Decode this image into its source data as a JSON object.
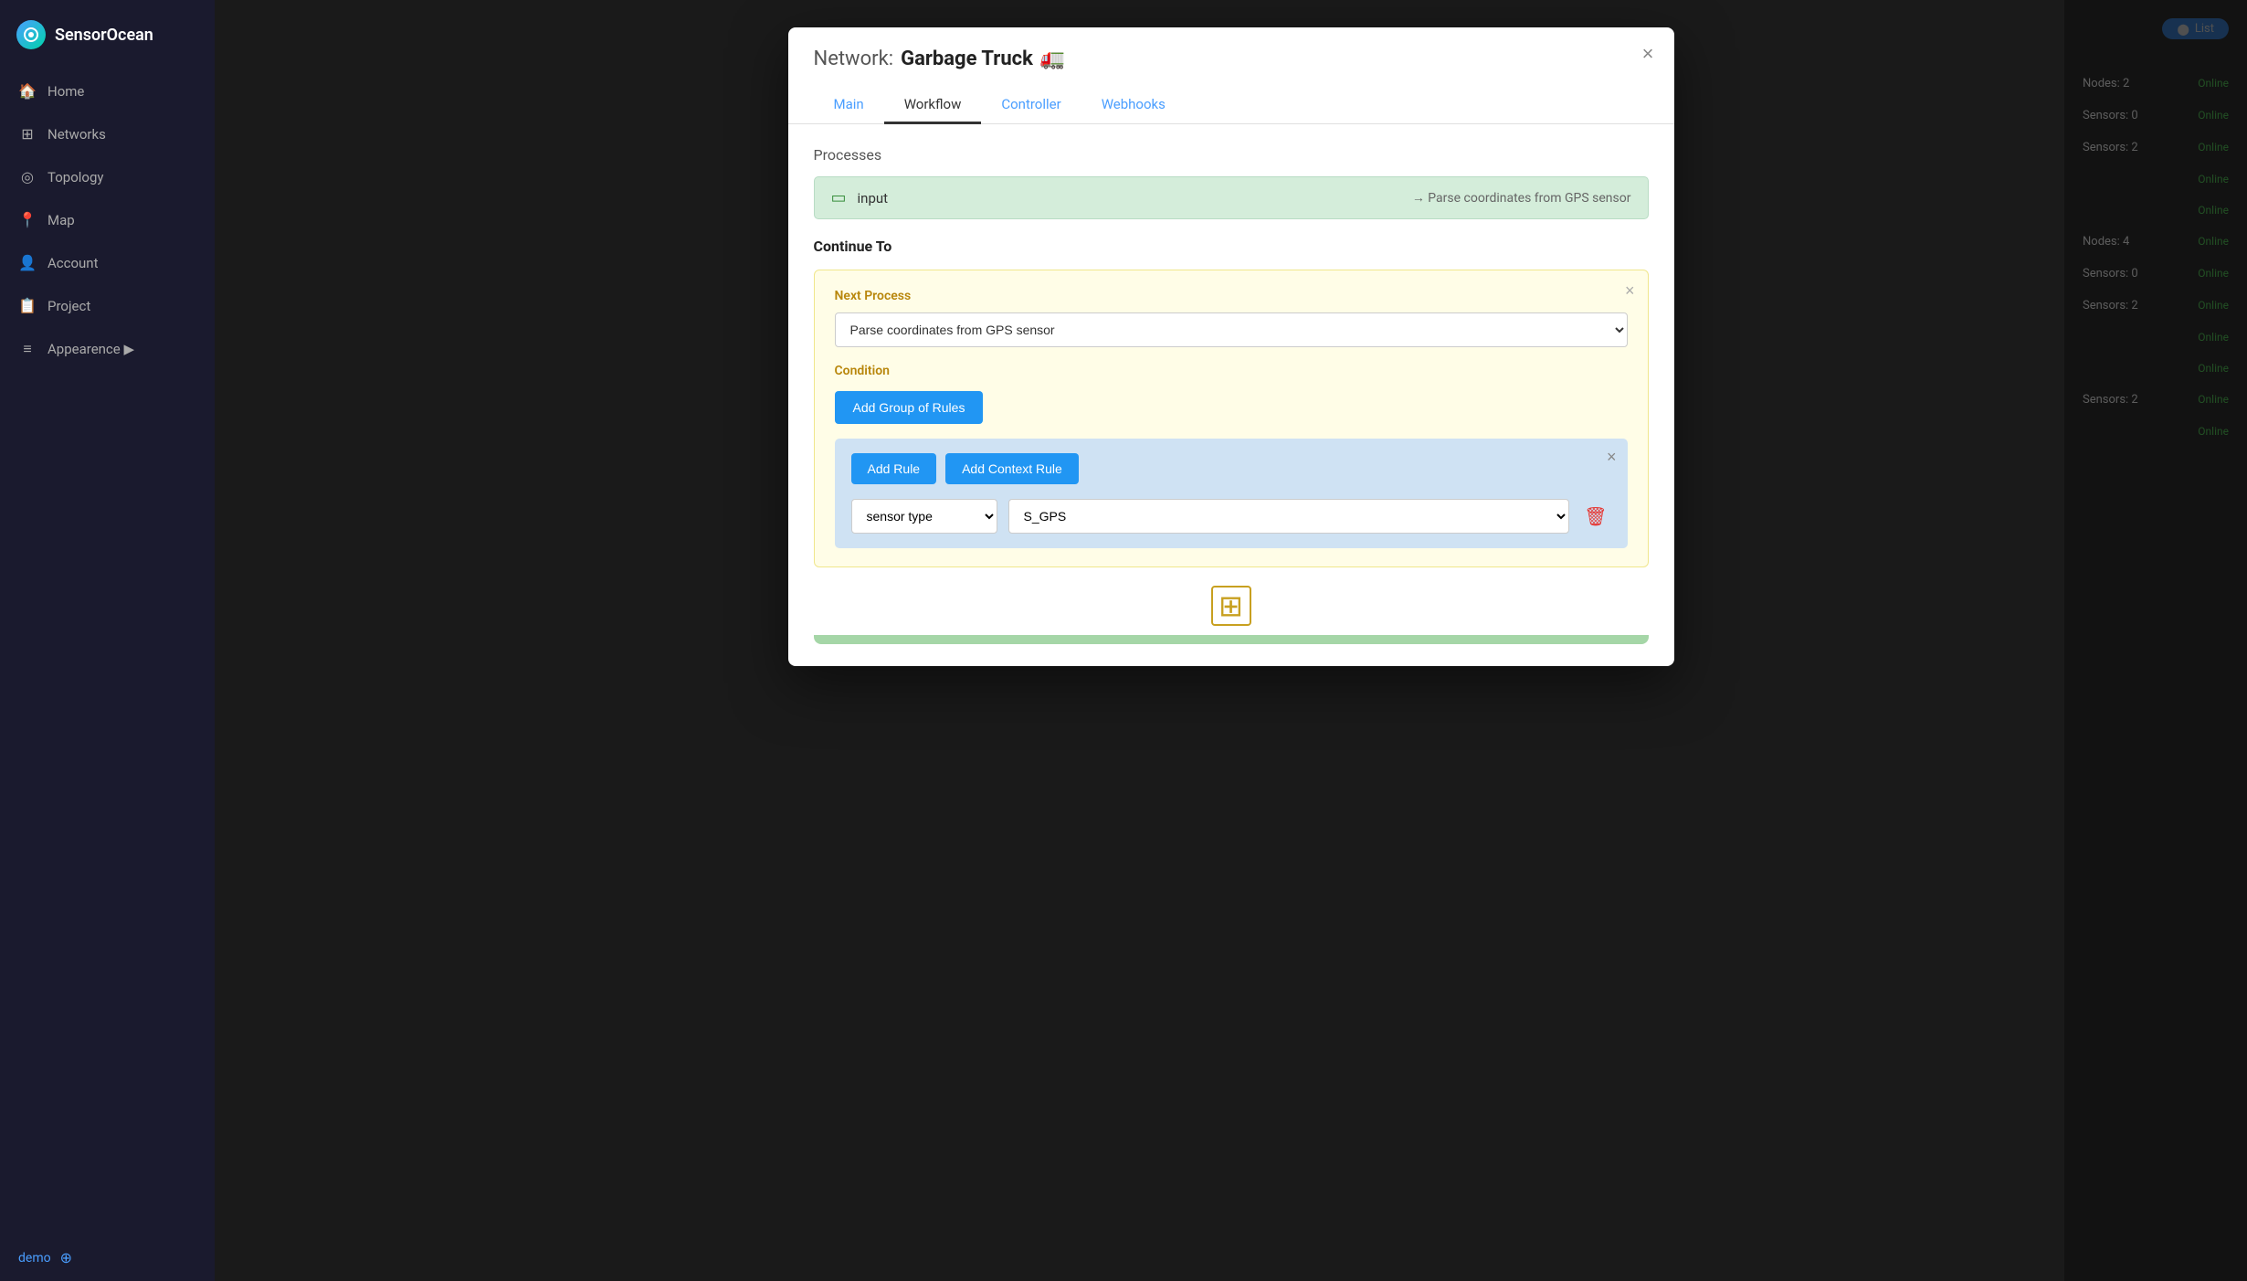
{
  "app": {
    "name": "SensorOcean"
  },
  "sidebar": {
    "items": [
      {
        "id": "home",
        "label": "Home",
        "icon": "🏠"
      },
      {
        "id": "networks",
        "label": "Networks",
        "icon": "⊞"
      },
      {
        "id": "topology",
        "label": "Topology",
        "icon": "◎"
      },
      {
        "id": "map",
        "label": "Map",
        "icon": "📍"
      },
      {
        "id": "account",
        "label": "Account",
        "icon": "👤"
      },
      {
        "id": "project",
        "label": "Project",
        "icon": "📋"
      },
      {
        "id": "appearance",
        "label": "Appearence ▶",
        "icon": "≡"
      }
    ],
    "demo_label": "demo"
  },
  "toggle": {
    "label": "List"
  },
  "right_panel": {
    "items": [
      {
        "label": "Nodes: 2",
        "status": "Online"
      },
      {
        "label": "Sensors: 0",
        "status": "Online"
      },
      {
        "label": "Sensors: 2",
        "status": "Online"
      },
      {
        "label": "",
        "status": "Online"
      },
      {
        "label": "",
        "status": "Online"
      },
      {
        "label": "Nodes: 4",
        "status": "Online"
      },
      {
        "label": "Sensors: 0",
        "status": "Online"
      },
      {
        "label": "Sensors: 2",
        "status": "Online"
      },
      {
        "label": "",
        "status": "Online"
      },
      {
        "label": "",
        "status": "Online"
      },
      {
        "label": "Sensors: 2",
        "status": "Online"
      },
      {
        "label": "",
        "status": "Online"
      }
    ]
  },
  "modal": {
    "title_label": "Network:",
    "title_name": "Garbage Truck",
    "title_emoji": "🚛",
    "close_icon": "×",
    "tabs": [
      {
        "id": "main",
        "label": "Main"
      },
      {
        "id": "workflow",
        "label": "Workflow"
      },
      {
        "id": "controller",
        "label": "Controller"
      },
      {
        "id": "webhooks",
        "label": "Webhooks"
      }
    ],
    "active_tab": "workflow",
    "processes_title": "Processes",
    "process": {
      "name": "input",
      "arrow": "→ Parse coordinates from GPS sensor"
    },
    "continue_to": "Continue To",
    "next_process": {
      "label": "Next Process",
      "selected": "Parse coordinates from GPS sensor",
      "options": [
        "Parse coordinates from GPS sensor"
      ]
    },
    "condition_label": "Condition",
    "add_group_btn": "Add Group of Rules",
    "rules_group": {
      "add_rule_btn": "Add Rule",
      "add_context_rule_btn": "Add Context Rule",
      "rule": {
        "type_selected": "sensor type",
        "type_options": [
          "sensor type"
        ],
        "value_selected": "S_GPS",
        "value_options": [
          "S_GPS"
        ]
      }
    },
    "add_more_icon": "⊞"
  }
}
